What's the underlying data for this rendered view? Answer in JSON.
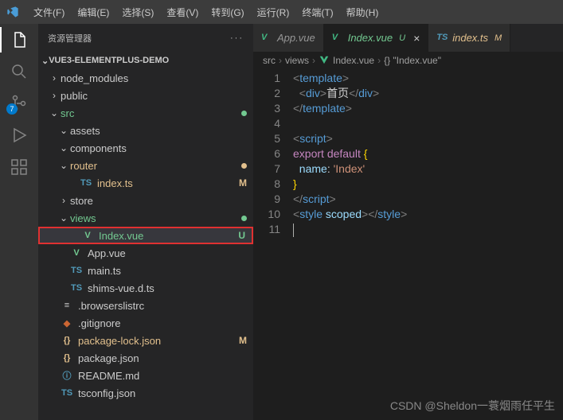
{
  "menu": [
    "文件(F)",
    "编辑(E)",
    "选择(S)",
    "查看(V)",
    "转到(G)",
    "运行(R)",
    "终端(T)",
    "帮助(H)"
  ],
  "activity": {
    "scm_badge": "7"
  },
  "sidebar": {
    "title": "资源管理器",
    "root": "VUE3-ELEMENTPLUS-DEMO",
    "tree": [
      {
        "d": 1,
        "t": "folder",
        "open": false,
        "label": "node_modules"
      },
      {
        "d": 1,
        "t": "folder",
        "open": false,
        "label": "public"
      },
      {
        "d": 1,
        "t": "folder",
        "open": true,
        "label": "src",
        "cls": "green",
        "dot": "#73c991"
      },
      {
        "d": 2,
        "t": "folder",
        "open": true,
        "label": "assets"
      },
      {
        "d": 2,
        "t": "folder",
        "open": true,
        "label": "components"
      },
      {
        "d": 2,
        "t": "folder",
        "open": true,
        "label": "router",
        "cls": "yellow",
        "dot": "#e2c08d"
      },
      {
        "d": 3,
        "t": "file",
        "ico": "TS",
        "icoCls": "blue",
        "label": "index.ts",
        "cls": "yellow",
        "stat": "M"
      },
      {
        "d": 2,
        "t": "folder",
        "open": false,
        "label": "store"
      },
      {
        "d": 2,
        "t": "folder",
        "open": true,
        "label": "views",
        "cls": "green",
        "dot": "#73c991"
      },
      {
        "d": 3,
        "t": "file",
        "ico": "V",
        "icoCls": "green",
        "label": "Index.vue",
        "cls": "green",
        "stat": "U",
        "sel": true,
        "red": true
      },
      {
        "d": 2,
        "t": "file",
        "ico": "V",
        "icoCls": "green",
        "label": "App.vue"
      },
      {
        "d": 2,
        "t": "file",
        "ico": "TS",
        "icoCls": "blue",
        "label": "main.ts"
      },
      {
        "d": 2,
        "t": "file",
        "ico": "TS",
        "icoCls": "blue",
        "label": "shims-vue.d.ts"
      },
      {
        "d": 1,
        "t": "file",
        "ico": "≡",
        "icoCls": "",
        "label": ".browserslistrc"
      },
      {
        "d": 1,
        "t": "file",
        "ico": "◆",
        "icoCls": "orange",
        "label": ".gitignore"
      },
      {
        "d": 1,
        "t": "file",
        "ico": "{}",
        "icoCls": "yellow",
        "label": "package-lock.json",
        "cls": "yellow",
        "stat": "M"
      },
      {
        "d": 1,
        "t": "file",
        "ico": "{}",
        "icoCls": "yellow",
        "label": "package.json"
      },
      {
        "d": 1,
        "t": "file",
        "ico": "ⓘ",
        "icoCls": "blue",
        "label": "README.md"
      },
      {
        "d": 1,
        "t": "file",
        "ico": "TS",
        "icoCls": "blue",
        "label": "tsconfig.json"
      }
    ]
  },
  "tabs": [
    {
      "ico": "V",
      "label": "App.vue",
      "active": false
    },
    {
      "ico": "V",
      "label": "Index.vue",
      "suffix": "U",
      "sufCls": "green",
      "active": true,
      "close": true,
      "cls": "green"
    },
    {
      "ico": "TS",
      "label": "index.ts",
      "suffix": "M",
      "sufCls": "yellow",
      "active": false,
      "cls": "yellow"
    }
  ],
  "crumbs": [
    "src",
    "views",
    "Index.vue",
    "{} \"Index.vue\""
  ],
  "code": {
    "lines": [
      1,
      2,
      3,
      4,
      5,
      6,
      7,
      8,
      9,
      10,
      11
    ],
    "content": {
      "l2_text": "首页",
      "l7_key": "name",
      "l7_val": "'Index'"
    }
  },
  "watermark": "CSDN @Sheldon一蓑烟雨任平生"
}
